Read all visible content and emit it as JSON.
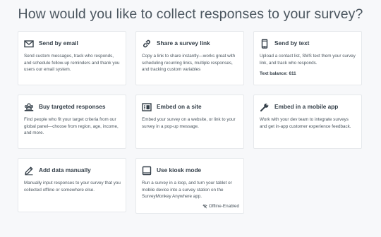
{
  "page": {
    "title": "How would you like to collect responses to your survey?"
  },
  "cards": [
    {
      "id": "email",
      "title": "Send by email",
      "icon": "envelope-icon",
      "description": "Send custom messages, track who responds, and schedule follow-up reminders and thank you users our email system."
    },
    {
      "id": "link",
      "title": "Share a survey link",
      "icon": "link-icon",
      "description": "Copy a link to share instantly—works great with scheduling recurring links, multiple responses, and tracking custom variables"
    },
    {
      "id": "text",
      "title": "Send by text",
      "icon": "mobile-phone-icon",
      "description": "Upload a contact list, SMS text them your survey link, and track who responds.",
      "extra": "Text balance: 611"
    },
    {
      "id": "targeted",
      "title": "Buy targeted responses",
      "icon": "people-group-icon",
      "description": "Find people who fit your target criteria from our global panel—choose from region, age, income, and more."
    },
    {
      "id": "embed-site",
      "title": "Embed on a site",
      "icon": "embed-page-icon",
      "description": "Embed your survey on a website, or link to your survey in a pop-up message."
    },
    {
      "id": "embed-mobile",
      "title": "Embed in a mobile app",
      "icon": "wrench-icon",
      "description": "Work with your dev team to integrate surveys and get in-app customer experience feedback."
    },
    {
      "id": "manual",
      "title": "Add data manually",
      "icon": "pencil-icon",
      "description": "Manually input responses to your survey that you collected offline or somewhere else."
    },
    {
      "id": "kiosk",
      "title": "Use kiosk mode",
      "icon": "tablet-icon",
      "description": "Run a survey in a loop, and turn your tablet or mobile device into a survey station on the SurveyMonkey Anywhere app.",
      "badge": "Offline-Enabled",
      "badge_icon": "wifi-off-icon"
    }
  ]
}
